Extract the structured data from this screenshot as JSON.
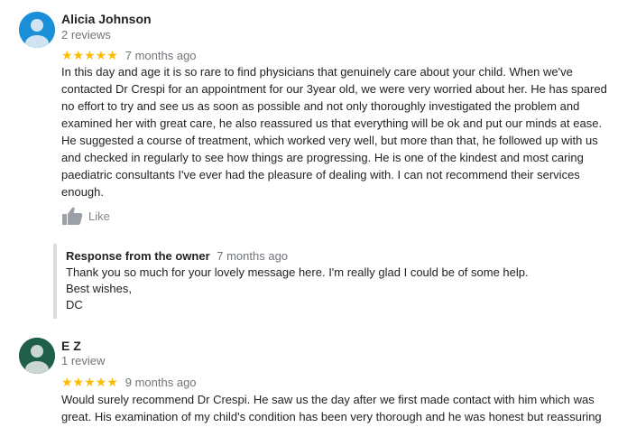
{
  "reviews": [
    {
      "name": "Alicia Johnson",
      "count": "2 reviews",
      "stars": "★★★★★",
      "rating": 5,
      "age": "7 months ago",
      "text": "In this day and age it is so rare to find physicians that genuinely care about your child. When we've contacted Dr Crespi for an appointment for our 3year old, we were very worried about her. He has spared no effort to try and see us as soon as possible and not only thoroughly investigated the problem and examined her with great care, he also reassured us that everything will be ok and put our minds at ease.  He suggested a course of treatment, which worked very well, but more than that, he followed up with us and checked in regularly to see how things are progressing. He is one of the kindest and most caring paediatric consultants I've ever had the pleasure of dealing with. I can not recommend their services enough.",
      "like_label": "Like",
      "avatar_color": "#1a8fd8"
    },
    {
      "name": "E Z",
      "count": "1 review",
      "stars": "★★★★★",
      "rating": 5,
      "age": "9 months ago",
      "text": "Would surely recommend Dr Crespi. He saw us the day after we first made contact with him which was great. His examination of my child's condition has been very thorough and he was honest but reassuring",
      "avatar_color": "#1f5e4b"
    }
  ],
  "owner_response": {
    "title": "Response from the owner",
    "age": "7 months ago",
    "lines": [
      "Thank you so much for your lovely message here. I'm really glad I could be of some help.",
      "Best wishes,",
      "DC"
    ]
  },
  "colors": {
    "star": "#fbbc04",
    "muted": "#70757a",
    "border": "#dadce0"
  }
}
